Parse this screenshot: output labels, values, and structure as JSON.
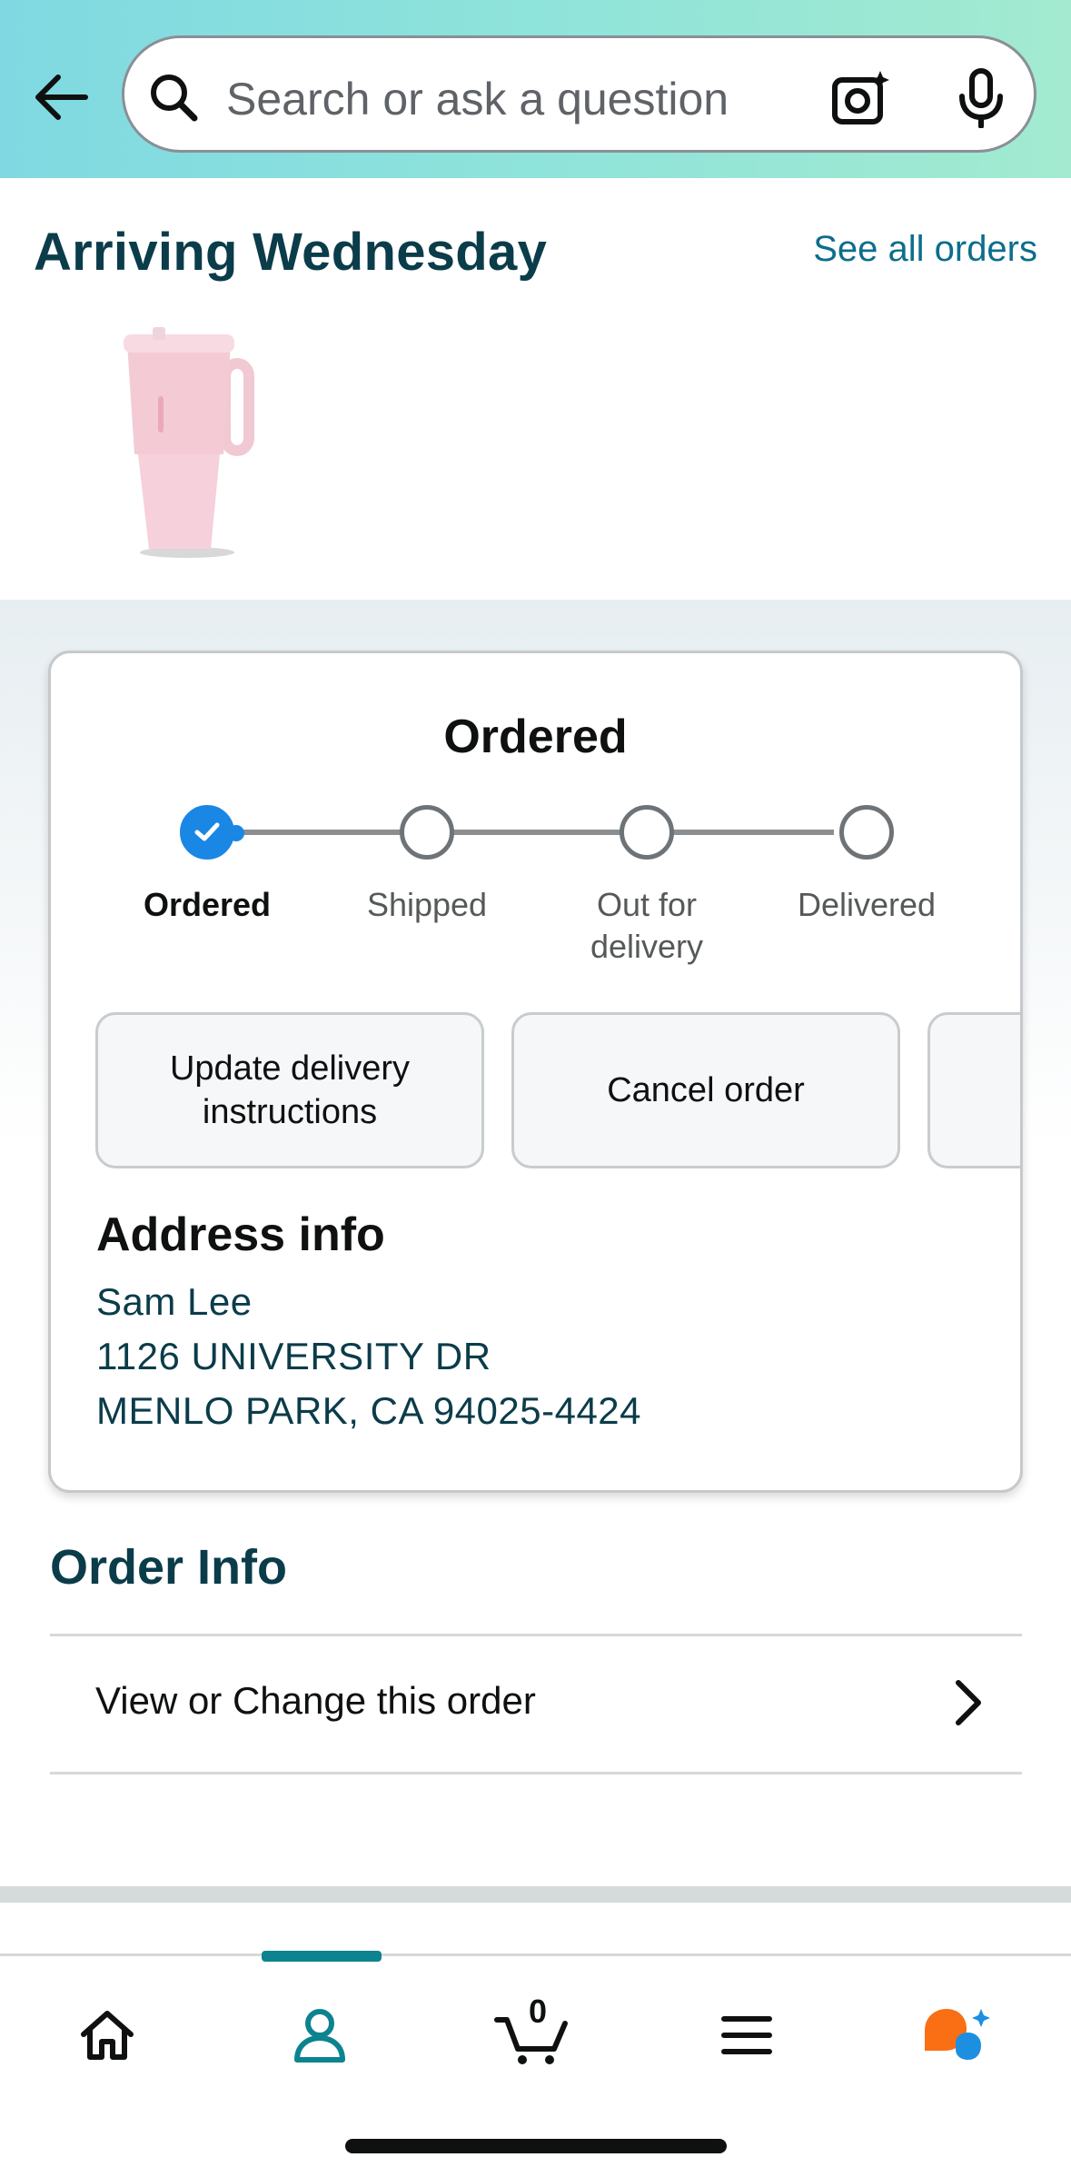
{
  "header": {
    "search_placeholder": "Search or ask a question"
  },
  "arriving": {
    "title": "Arriving Wednesday",
    "see_all_label": "See all orders"
  },
  "status_card": {
    "title": "Ordered",
    "steps": [
      {
        "label": "Ordered",
        "state": "done"
      },
      {
        "label": "Shipped",
        "state": "pending"
      },
      {
        "label": "Out for delivery",
        "state": "pending"
      },
      {
        "label": "Delivered",
        "state": "pending"
      }
    ],
    "actions": [
      {
        "label": "Update delivery instructions"
      },
      {
        "label": "Cancel order"
      }
    ],
    "address": {
      "title": "Address info",
      "name": "Sam Lee",
      "line1": "1126 UNIVERSITY DR",
      "line2": "MENLO PARK, CA 94025-4424"
    }
  },
  "order_info": {
    "title": "Order Info",
    "row_label": "View or Change this order"
  },
  "bottom_nav": {
    "cart_count": "0",
    "active_tab": "account",
    "items": [
      "home-icon",
      "account-icon",
      "cart-icon",
      "menu-icon",
      "rufus-icon"
    ]
  },
  "colors": {
    "accent": "#0d8390",
    "link": "#0d6d8c",
    "progress_done": "#1a87e5",
    "heading": "#0b3c4a"
  }
}
